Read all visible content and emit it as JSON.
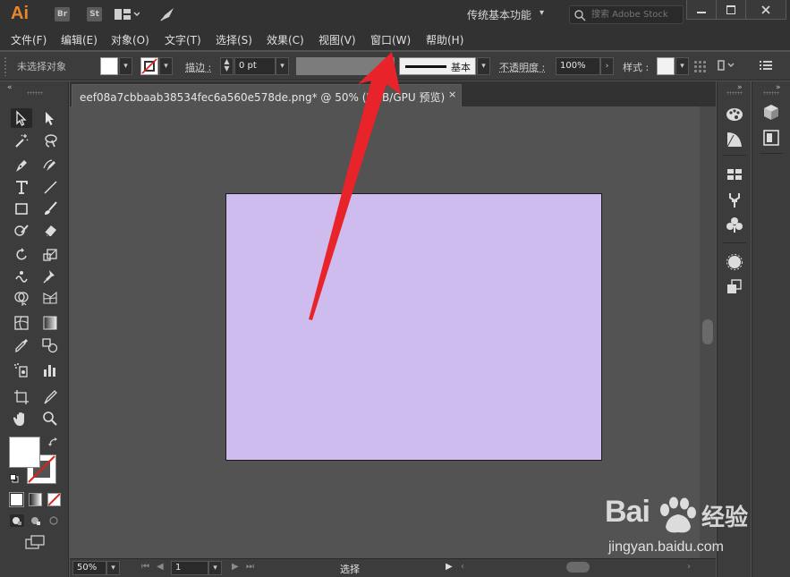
{
  "app": {
    "logo": "Ai",
    "badges": [
      "Br",
      "St"
    ],
    "workspace": "传统基本功能",
    "search_placeholder": "搜索 Adobe Stock",
    "accent": "#e8852e"
  },
  "menu": [
    "文件(F)",
    "编辑(E)",
    "对象(O)",
    "文字(T)",
    "选择(S)",
    "效果(C)",
    "视图(V)",
    "窗口(W)",
    "帮助(H)"
  ],
  "control": {
    "selection_label": "未选择对象",
    "stroke_label": "描边 :",
    "stroke_value": "0 pt",
    "brush_label": "基本",
    "opacity_label": "不透明度 :",
    "opacity_value": "100%",
    "style_label": "样式 :"
  },
  "document": {
    "tab_title": "eef08a7cbbaab38534fec6a560e578de.png* @ 50% (RGB/GPU 预览)",
    "close_symbol": "×",
    "artboard_color": "#cebcee"
  },
  "status": {
    "zoom": "50%",
    "page": "1",
    "tool": "选择"
  },
  "annotation": {
    "arrow_color": "#e8232a"
  },
  "watermark": {
    "brand": "Bai",
    "brand_suffix": "经验",
    "url": "jingyan.baidu.com"
  },
  "icons": [
    "window-layout-icon",
    "rocket-icon",
    "search-icon",
    "minimize-icon",
    "maximize-icon",
    "close-icon",
    "selection-tool-icon",
    "direct-selection-icon",
    "magic-wand-icon",
    "lasso-icon",
    "pen-icon",
    "curvature-icon",
    "type-tool-icon",
    "line-tool-icon",
    "rectangle-tool-icon",
    "paintbrush-icon",
    "shaper-icon",
    "eraser-icon",
    "rotate-icon",
    "scale-icon",
    "warp-icon",
    "pin-icon",
    "shape-builder-icon",
    "perspective-icon",
    "mesh-icon",
    "gradient-icon",
    "eyedropper-icon",
    "blend-icon",
    "symbol-sprayer-icon",
    "column-graph-icon",
    "artboard-tool-icon",
    "slice-icon",
    "hand-icon",
    "zoom-icon",
    "color-panel-icon",
    "color-guide-icon",
    "swatches-icon",
    "brushes-icon",
    "symbols-icon",
    "appearance-icon",
    "transparency-icon",
    "libraries-icon",
    "properties-icon"
  ]
}
